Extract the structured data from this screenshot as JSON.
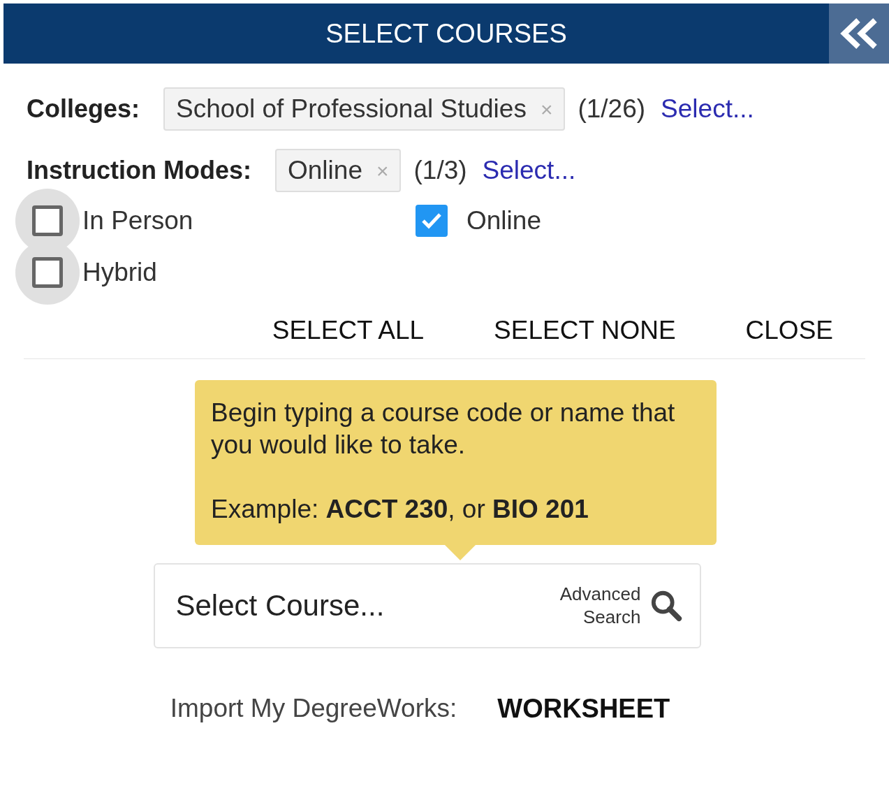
{
  "header": {
    "title": "SELECT COURSES"
  },
  "filters": [
    {
      "label": "Colleges:",
      "chips": [
        {
          "label": "School of Professional Studies",
          "remove": "×"
        }
      ],
      "count": "(1/26)",
      "link": "Select..."
    },
    {
      "label": "Instruction Modes:",
      "chips": [
        {
          "label": "Online",
          "remove": "×"
        }
      ],
      "count": "(1/3)",
      "link": "Select..."
    }
  ],
  "modes": [
    {
      "label": "In Person",
      "checked": false,
      "highlighted": true
    },
    {
      "label": "Online",
      "checked": true,
      "highlighted": false
    },
    {
      "label": "Hybrid",
      "checked": false,
      "highlighted": true
    }
  ],
  "actions": [
    "SELECT ALL",
    "SELECT NONE",
    "CLOSE"
  ],
  "tooltip": {
    "text": "Begin typing a course code or name that you would like to take.",
    "example": "Example: **ACCT 230**, or **BIO 201**"
  },
  "search": {
    "placeholder": "Select Course...",
    "advanced": "Advanced Search"
  },
  "import": {
    "label": "Import My DegreeWorks:",
    "button": "WORKSHEET"
  }
}
